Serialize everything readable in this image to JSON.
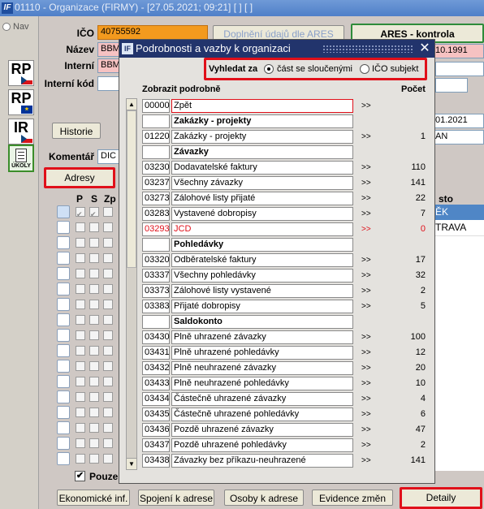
{
  "window": {
    "title": "01110 - Organizace (FIRMY) - [27.05.2021; 09:21]  [ ]  [ ]",
    "nav_label": "Nav"
  },
  "sidebar": {
    "icons": [
      {
        "label": "RP",
        "flag": "cz"
      },
      {
        "label": "RP",
        "flag": "eu"
      },
      {
        "label": "IR",
        "flag": "cz"
      },
      {
        "label": "ÚKOLY",
        "flag": ""
      }
    ]
  },
  "form": {
    "ico_label": "IČO",
    "ico_value": "40755592",
    "nazev_label": "Název",
    "nazev_value": "BBM",
    "interni_label": "Interní",
    "interni_value": "BBM",
    "interni_kod_label": "Interní kód",
    "complete_button": "Doplnění údajů dle ARES",
    "ares_button": "ARES - kontrola",
    "date_right_1": "10.1991",
    "date_right_2": "01.2021",
    "right_text": "AN",
    "historie_button": "Historie",
    "komentar_label": "Komentář",
    "komentar_value": "DIC r",
    "adresy_tab": "Adresy",
    "col_p": "P",
    "col_s": "S",
    "col_zp": "Zp",
    "col_right": "sto",
    "right_row_1": "ĚK",
    "right_row_2": "TRAVA",
    "pouze_label": "Pouze"
  },
  "bottom_buttons": [
    "Ekonomické inf.",
    "Spojení k adrese",
    "Osoby k adrese",
    "Evidence změn",
    "Detaily"
  ],
  "dialog": {
    "title": "Podrobnosti a vazby k organizaci",
    "close": "✕",
    "search_label": "Vyhledat za",
    "option_1": "část se sloučenými",
    "option_2": "IČO subjekt",
    "selected_option": "option_1",
    "col_detail": "Zobrazit podrobně",
    "col_count": "Počet",
    "rows": [
      {
        "code": "00000",
        "name": "Zpět",
        "arrow": ">>",
        "count": "",
        "type": "selected"
      },
      {
        "code": "",
        "name": "Zakázky - projekty",
        "arrow": "",
        "count": "",
        "type": "section"
      },
      {
        "code": "01220",
        "name": "Zakázky - projekty",
        "arrow": ">>",
        "count": "1",
        "type": "item"
      },
      {
        "code": "",
        "name": "Závazky",
        "arrow": "",
        "count": "",
        "type": "section"
      },
      {
        "code": "03230",
        "name": "Dodavatelské faktury",
        "arrow": ">>",
        "count": "110",
        "type": "item"
      },
      {
        "code": "03237",
        "name": "Všechny závazky",
        "arrow": ">>",
        "count": "141",
        "type": "item"
      },
      {
        "code": "03273",
        "name": "Zálohové listy přijaté",
        "arrow": ">>",
        "count": "22",
        "type": "item"
      },
      {
        "code": "03283",
        "name": "Vystavené dobropisy",
        "arrow": ">>",
        "count": "7",
        "type": "item"
      },
      {
        "code": "03293",
        "name": "JCD",
        "arrow": ">>",
        "count": "0",
        "type": "red"
      },
      {
        "code": "",
        "name": "Pohledávky",
        "arrow": "",
        "count": "",
        "type": "section"
      },
      {
        "code": "03320",
        "name": "Odběratelské faktury",
        "arrow": ">>",
        "count": "17",
        "type": "item"
      },
      {
        "code": "03337",
        "name": "Všechny pohledávky",
        "arrow": ">>",
        "count": "32",
        "type": "item"
      },
      {
        "code": "03373",
        "name": "Zálohové listy vystavené",
        "arrow": ">>",
        "count": "2",
        "type": "item"
      },
      {
        "code": "03383",
        "name": "Přijaté dobropisy",
        "arrow": ">>",
        "count": "5",
        "type": "item"
      },
      {
        "code": "",
        "name": "Saldokonto",
        "arrow": "",
        "count": "",
        "type": "section"
      },
      {
        "code": "03430",
        "name": "Plně uhrazené závazky",
        "arrow": ">>",
        "count": "100",
        "type": "item"
      },
      {
        "code": "03431",
        "name": "Plně uhrazené pohledávky",
        "arrow": ">>",
        "count": "12",
        "type": "item"
      },
      {
        "code": "03432",
        "name": "Plně neuhrazené závazky",
        "arrow": ">>",
        "count": "20",
        "type": "item"
      },
      {
        "code": "03433",
        "name": "Plně neuhrazené pohledávky",
        "arrow": ">>",
        "count": "10",
        "type": "item"
      },
      {
        "code": "03434",
        "name": "Částečně uhrazené závazky",
        "arrow": ">>",
        "count": "4",
        "type": "item"
      },
      {
        "code": "03435",
        "name": "Částečně uhrazené pohledávky",
        "arrow": ">>",
        "count": "6",
        "type": "item"
      },
      {
        "code": "03436",
        "name": "Pozdě uhrazené závazky",
        "arrow": ">>",
        "count": "47",
        "type": "item"
      },
      {
        "code": "03437",
        "name": "Pozdě uhrazené pohledávky",
        "arrow": ">>",
        "count": "2",
        "type": "item"
      },
      {
        "code": "03438",
        "name": "Závazky bez příkazu-neuhrazené",
        "arrow": ">>",
        "count": "141",
        "type": "item"
      }
    ]
  },
  "colors": {
    "highlight_red": "#e0101a",
    "dialog_title_bg": "#22346c",
    "ico_field_bg": "#f39a1e",
    "ares_green": "#2e8b3a"
  }
}
